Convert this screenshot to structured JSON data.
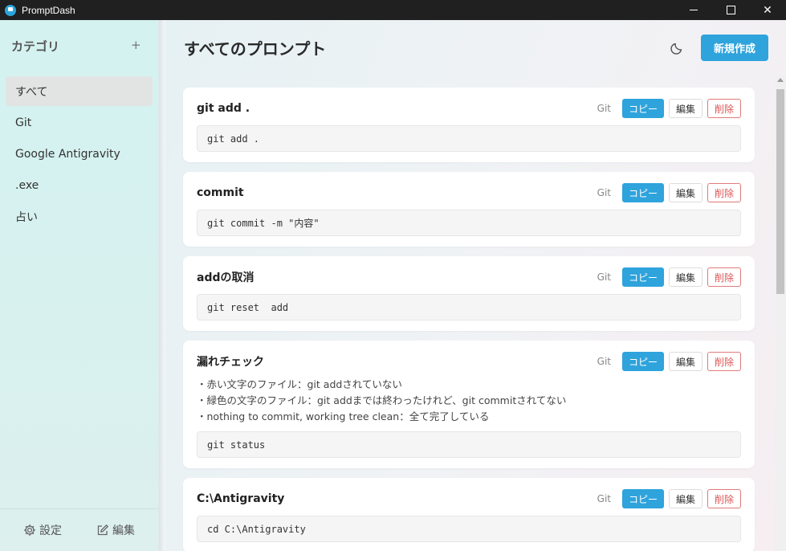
{
  "window": {
    "title": "PromptDash",
    "close_glyph": "✕"
  },
  "sidebar": {
    "header": "カテゴリ",
    "add_glyph": "+",
    "categories": [
      {
        "label": "すべて",
        "active": true
      },
      {
        "label": "Git",
        "active": false
      },
      {
        "label": "Google Antigravity",
        "active": false
      },
      {
        "label": ".exe",
        "active": false
      },
      {
        "label": "占い",
        "active": false
      }
    ],
    "footer": {
      "settings_label": "設定",
      "edit_label": "編集"
    }
  },
  "main": {
    "title": "すべてのプロンプト",
    "new_button": "新規作成",
    "buttons": {
      "copy": "コピー",
      "edit": "編集",
      "delete": "削除"
    },
    "prompts": [
      {
        "title": "git add .",
        "tag": "Git",
        "description": [],
        "code": "git add ."
      },
      {
        "title": "commit",
        "tag": "Git",
        "description": [],
        "code": "git commit -m \"内容\""
      },
      {
        "title": "addの取消",
        "tag": "Git",
        "description": [],
        "code": "git reset  add"
      },
      {
        "title": "漏れチェック",
        "tag": "Git",
        "description": [
          "・赤い文字のファイル：git addされていない",
          "・緑色の文字のファイル：git addまでは終わったけれど、git commitされてない",
          "・nothing to commit, working tree clean：全て完了している"
        ],
        "code": "git status"
      },
      {
        "title": "C:\\Antigravity",
        "tag": "Git",
        "description": [],
        "code": "cd C:\\Antigravity"
      }
    ]
  },
  "colors": {
    "accent": "#2ea3dc",
    "danger": "#d55555",
    "titlebar": "#202020"
  },
  "icons": {
    "app": "app-logo-icon",
    "theme": "moon-icon",
    "settings": "gear-icon",
    "edit": "pencil-square-icon"
  }
}
